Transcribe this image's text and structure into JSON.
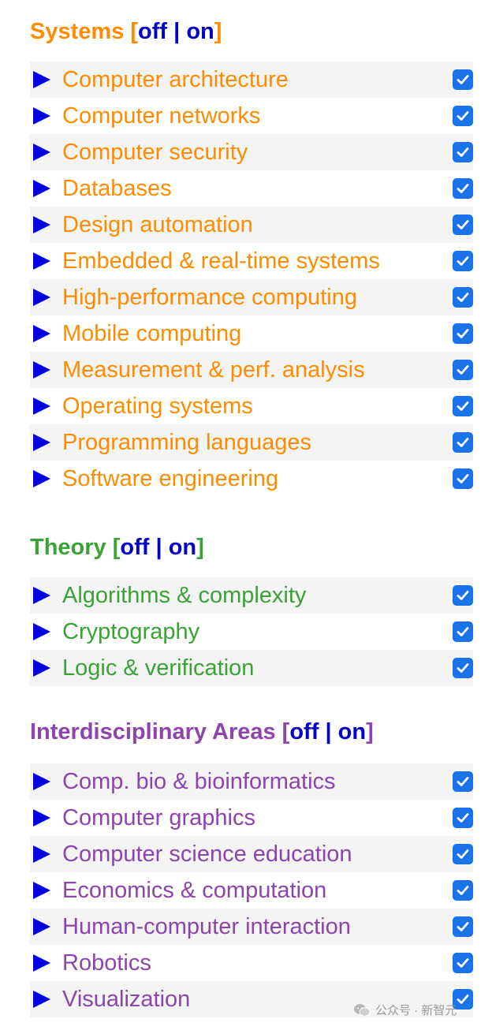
{
  "colors": {
    "systems": "#ff8c00",
    "theory": "#3aa335",
    "interdisciplinary": "#8e44ad",
    "toggle_link": "#0000c8",
    "expand_arrow": "#0000e0",
    "checkbox": "#1a73e8"
  },
  "icons": {
    "expand": "triangle-right-icon",
    "checkbox": "checkmark-icon",
    "watermark": "wechat-icon"
  },
  "sections": [
    {
      "title": "Systems",
      "toggle": {
        "open": "[",
        "off": "off",
        "sep": "|",
        "on": "on",
        "close": "]"
      },
      "items": [
        {
          "label": "Computer architecture",
          "checked": true
        },
        {
          "label": "Computer networks",
          "checked": true
        },
        {
          "label": "Computer security",
          "checked": true
        },
        {
          "label": "Databases",
          "checked": true
        },
        {
          "label": "Design automation",
          "checked": true
        },
        {
          "label": "Embedded & real-time systems",
          "checked": true
        },
        {
          "label": "High-performance computing",
          "checked": true
        },
        {
          "label": "Mobile computing",
          "checked": true
        },
        {
          "label": "Measurement & perf. analysis",
          "checked": true
        },
        {
          "label": "Operating systems",
          "checked": true
        },
        {
          "label": "Programming languages",
          "checked": true
        },
        {
          "label": "Software engineering",
          "checked": true
        }
      ]
    },
    {
      "title": "Theory",
      "toggle": {
        "open": "[",
        "off": "off",
        "sep": "|",
        "on": "on",
        "close": "]"
      },
      "items": [
        {
          "label": "Algorithms & complexity",
          "checked": true
        },
        {
          "label": "Cryptography",
          "checked": true
        },
        {
          "label": "Logic & verification",
          "checked": true
        }
      ]
    },
    {
      "title": "Interdisciplinary Areas",
      "toggle": {
        "open": "[",
        "off": "off",
        "sep": "|",
        "on": "on",
        "close": "]"
      },
      "items": [
        {
          "label": "Comp. bio & bioinformatics",
          "checked": true
        },
        {
          "label": "Computer graphics",
          "checked": true
        },
        {
          "label": "Computer science education",
          "checked": true
        },
        {
          "label": "Economics & computation",
          "checked": true
        },
        {
          "label": "Human-computer interaction",
          "checked": true
        },
        {
          "label": "Robotics",
          "checked": true
        },
        {
          "label": "Visualization",
          "checked": true
        }
      ]
    }
  ],
  "watermark": {
    "text": "公众号 · 新智元"
  }
}
